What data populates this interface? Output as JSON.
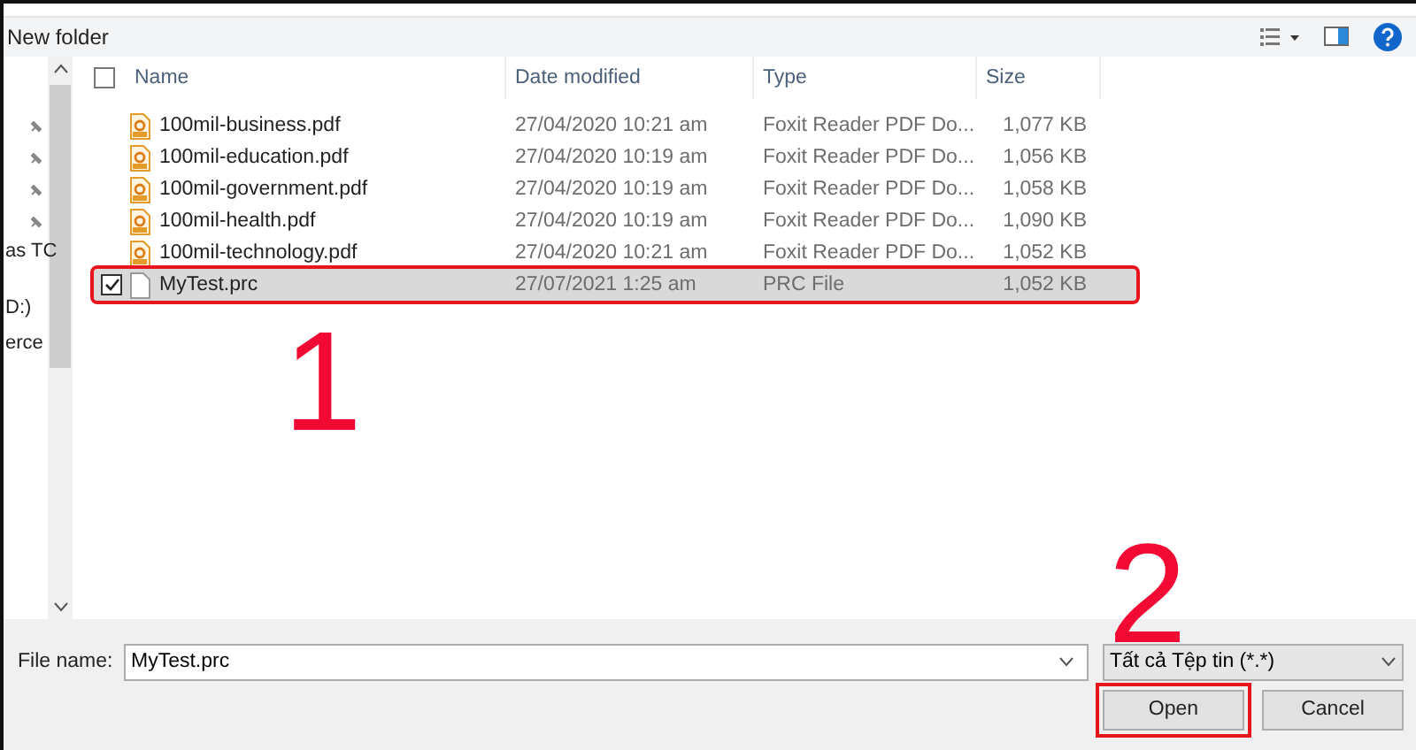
{
  "toolbar": {
    "new_folder": "New folder"
  },
  "sidebar": {
    "items": [
      {
        "label": "as TC"
      },
      {
        "label": "D:)"
      },
      {
        "label": "erce"
      }
    ]
  },
  "table": {
    "all_checked": false,
    "columns": [
      "Name",
      "Date modified",
      "Type",
      "Size"
    ],
    "rows": [
      {
        "kind": "pdf",
        "name": "100mil-business.pdf",
        "date": "27/04/2020 10:21 am",
        "type": "Foxit Reader PDF Do...",
        "size": "1,077 KB",
        "selected": false
      },
      {
        "kind": "pdf",
        "name": "100mil-education.pdf",
        "date": "27/04/2020 10:19 am",
        "type": "Foxit Reader PDF Do...",
        "size": "1,056 KB",
        "selected": false
      },
      {
        "kind": "pdf",
        "name": "100mil-government.pdf",
        "date": "27/04/2020 10:19 am",
        "type": "Foxit Reader PDF Do...",
        "size": "1,058 KB",
        "selected": false
      },
      {
        "kind": "pdf",
        "name": "100mil-health.pdf",
        "date": "27/04/2020 10:19 am",
        "type": "Foxit Reader PDF Do...",
        "size": "1,090 KB",
        "selected": false
      },
      {
        "kind": "pdf",
        "name": "100mil-technology.pdf",
        "date": "27/04/2020 10:21 am",
        "type": "Foxit Reader PDF Do...",
        "size": "1,052 KB",
        "selected": false
      },
      {
        "kind": "file",
        "name": "MyTest.prc",
        "date": "27/07/2021 1:25 am",
        "type": "PRC File",
        "size": "1,052 KB",
        "selected": true
      }
    ]
  },
  "footer": {
    "file_name_label": "File name:",
    "file_name": "MyTest.prc",
    "file_type": "Tất cả Tệp tin (*.*)",
    "open": "Open",
    "cancel": "Cancel"
  },
  "annotations": [
    "1",
    "2"
  ]
}
